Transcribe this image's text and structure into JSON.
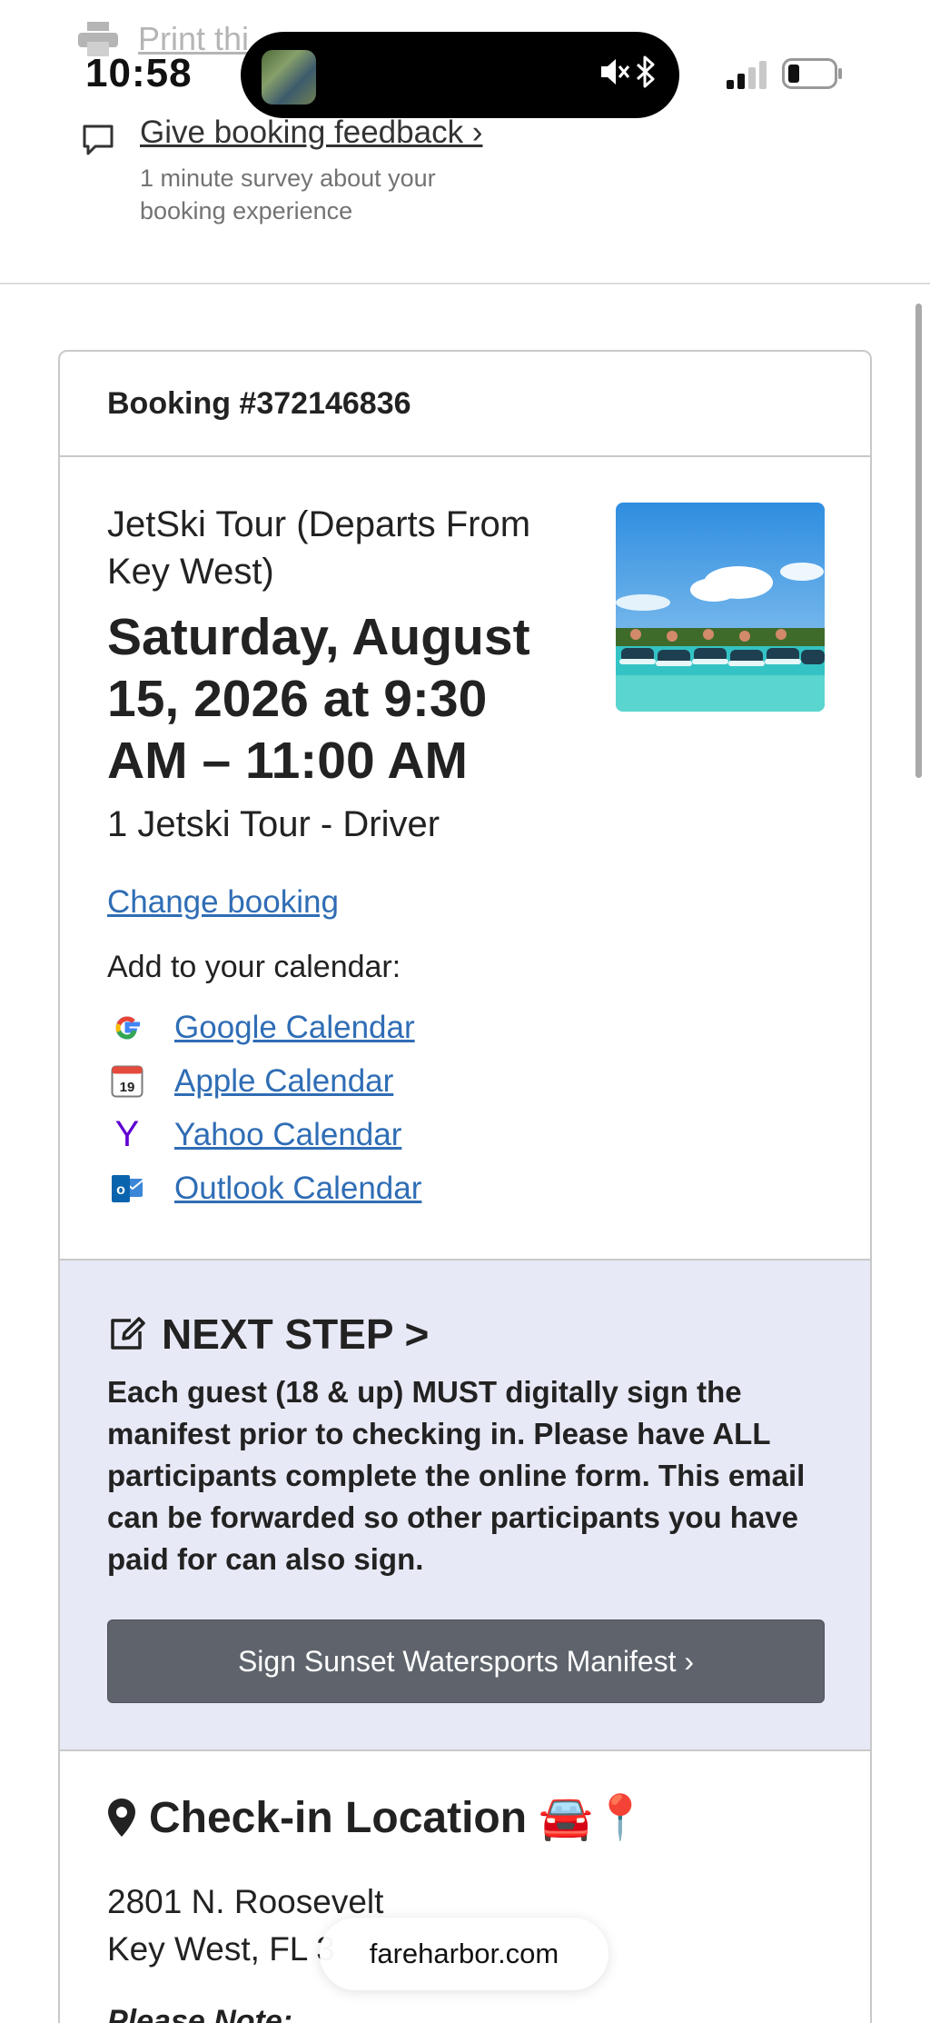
{
  "status_bar": {
    "time": "10:58",
    "print_label": "Print thi"
  },
  "header": {
    "feedback_link": "Give booking feedback ›",
    "feedback_sub": "1 minute survey about your booking experience"
  },
  "booking": {
    "number_label": "Booking #372146836",
    "tour_name": "JetSki Tour (Departs From Key West)",
    "date_time": "Saturday, August 15, 2026 at 9:30 AM – 11:00 AM",
    "quantity": "1 Jetski Tour - Driver",
    "change_link": "Change booking",
    "calendar_label": "Add to your calendar:",
    "calendars": [
      {
        "label": "Google Calendar",
        "icon": "google-icon"
      },
      {
        "label": "Apple Calendar",
        "icon": "apple-calendar-icon",
        "icon_text": "19"
      },
      {
        "label": "Yahoo Calendar",
        "icon": "yahoo-icon",
        "icon_text": "Y"
      },
      {
        "label": "Outlook Calendar",
        "icon": "outlook-icon",
        "icon_text": "o"
      }
    ]
  },
  "next_step": {
    "title": "NEXT STEP >",
    "body": "Each guest (18 & up) MUST digitally sign the manifest prior to checking in. Please have ALL participants complete the online form. This email can be forwarded so other participants you have paid for can also sign.",
    "button_label": "Sign Sunset Watersports Manifest ›"
  },
  "checkin": {
    "title": "Check-in Location 🚘📍",
    "address_line1": "2801 N. Roosevelt",
    "address_line2": "Key West, FL 3",
    "note": "Please Note:"
  },
  "browser": {
    "url": "fareharbor.com"
  },
  "colors": {
    "link": "#2f6db5",
    "next_step_bg": "#e8e9f6",
    "button_bg": "#5f646c",
    "google": [
      "#4285F4",
      "#EA4335",
      "#FBBC05",
      "#34A853"
    ],
    "yahoo": "#5f01d1",
    "outlook": "#0a64ad"
  }
}
